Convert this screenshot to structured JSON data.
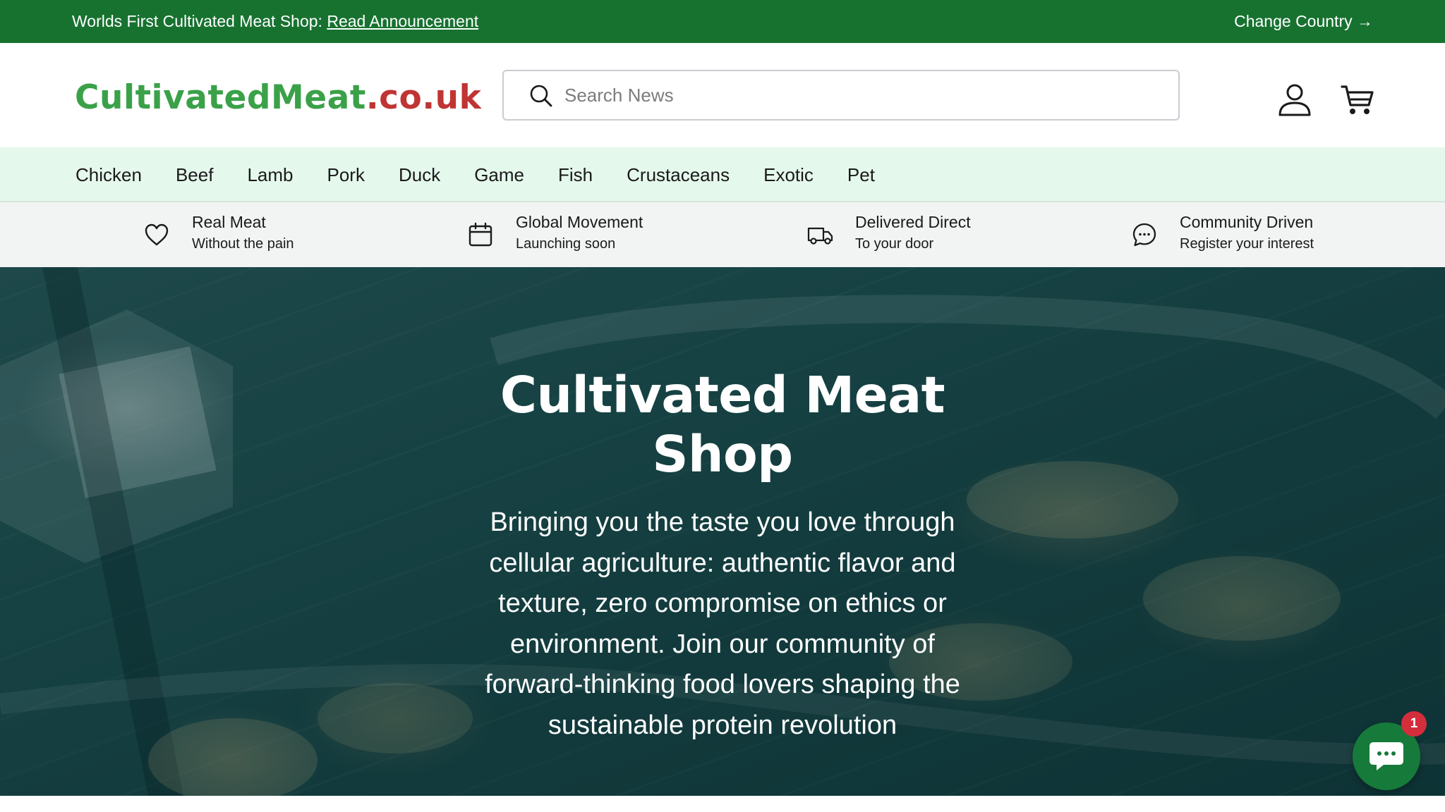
{
  "announcement": {
    "text": "Worlds First Cultivated Meat Shop: ",
    "link_label": "Read Announcement",
    "change_country": "Change Country →"
  },
  "header": {
    "logo_main": "CultivatedMeat",
    "logo_tld": ".co.uk",
    "search_placeholder": "Search News",
    "icons": [
      "search-icon",
      "account-icon",
      "cart-icon"
    ]
  },
  "categories": [
    "Chicken",
    "Beef",
    "Lamb",
    "Pork",
    "Duck",
    "Game",
    "Fish",
    "Crustaceans",
    "Exotic",
    "Pet"
  ],
  "features": [
    {
      "icon": "heart-icon",
      "title": "Real Meat",
      "subtitle": "Without the pain"
    },
    {
      "icon": "calendar-icon",
      "title": "Global Movement",
      "subtitle": "Launching soon"
    },
    {
      "icon": "truck-icon",
      "title": "Delivered Direct",
      "subtitle": "To your door"
    },
    {
      "icon": "chat-bubble-icon",
      "title": "Community Driven",
      "subtitle": "Register your interest"
    }
  ],
  "hero": {
    "title": "Cultivated Meat Shop",
    "subtitle": "Bringing you the taste you love through cellular agriculture: authentic flavor and texture, zero compromise on ethics or environment. Join our community of forward-thinking food lovers shaping the sustainable protein revolution"
  },
  "chat_widget": {
    "badge_count": "1"
  },
  "colors": {
    "announcement_bg": "#177230",
    "logo_green": "#3aa149",
    "logo_red": "#c03434",
    "nav_bg": "#e5f8ec",
    "features_bg": "#f2f3f3",
    "chat_bg": "#157a3a",
    "badge_bg": "#d42d3c"
  }
}
